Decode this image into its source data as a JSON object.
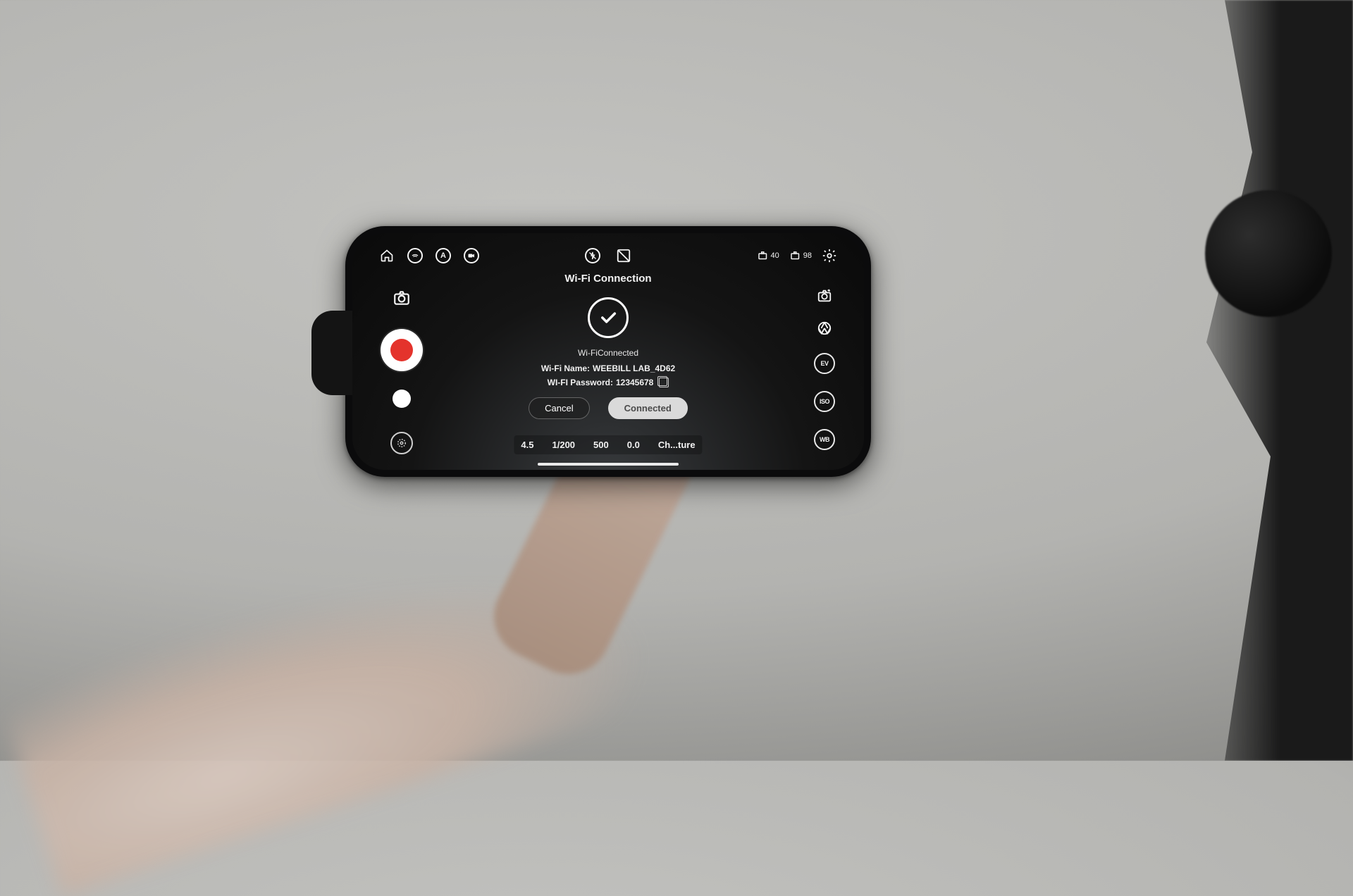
{
  "topbar": {
    "battery1": "40",
    "battery2": "98"
  },
  "modal": {
    "title": "Wi-Fi Connection",
    "status": "Wi-FiConnected",
    "name_label": "Wi-Fi Name:",
    "name_value": "WEEBILL LAB_4D62",
    "password_label": "WI-FI Password:",
    "password_value": "12345678",
    "cancel_label": "Cancel",
    "confirm_label": "Connected"
  },
  "right_badges": {
    "ev": "EV",
    "iso": "ISO",
    "wb": "WB"
  },
  "params": {
    "aperture": "4.5",
    "shutter": "1/200",
    "iso": "500",
    "ev": "0.0",
    "mode": "Ch...ture"
  }
}
